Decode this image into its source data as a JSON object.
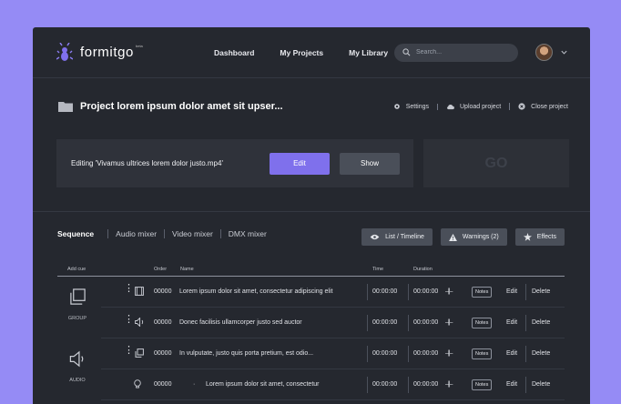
{
  "brand": {
    "name": "formitgo",
    "tm": "beta"
  },
  "nav": {
    "dashboard": "Dashboard",
    "projects": "My Projects",
    "library": "My Library"
  },
  "search": {
    "placeholder": "Search..."
  },
  "project": {
    "title": "Project lorem ipsum dolor amet sit upser...",
    "settings": "Settings",
    "upload": "Upload project",
    "close": "Close project"
  },
  "editor": {
    "label": "Editing 'Vivamus ultrices lorem dolor justo.mp4'",
    "edit": "Edit",
    "show": "Show",
    "go": "GO"
  },
  "tabs": [
    "Sequence",
    "Audio mixer",
    "Video mixer",
    "DMX mixer"
  ],
  "toolbar": {
    "list": "List / Timeline",
    "warnings": "Warnings (2)",
    "effects": "Effects"
  },
  "table": {
    "headers": {
      "add_cue": "Add cue",
      "order": "Order",
      "name": "Name",
      "time": "Time",
      "duration": "Duration"
    },
    "rows": [
      {
        "order": "00000",
        "name": "Lorem ipsum dolor sit amet, consectetur adipiscing elit",
        "time": "00:00:00",
        "duration": "00:00:00",
        "marker": "–||–",
        "notes": "Notes",
        "edit": "Edit",
        "delete": "Delete",
        "icon": "film-icon"
      },
      {
        "order": "00000",
        "name": "Donec facilisis ullamcorper justo sed auctor",
        "time": "00:00:00",
        "duration": "00:00:00",
        "marker": "–||–",
        "notes": "Notes",
        "edit": "Edit",
        "delete": "Delete",
        "icon": "speaker-icon"
      },
      {
        "order": "00000",
        "name": "In vulputate, justo quis porta pretium, est odio...",
        "time": "00:00:00",
        "duration": "00:00:00",
        "marker": "–||–",
        "notes": "Notes",
        "edit": "Edit",
        "delete": "Delete",
        "icon": "copy-icon"
      },
      {
        "order": "00000",
        "name": "Lorem ipsum dolor sit amet, consectetur",
        "time": "00:00:00",
        "duration": "00:00:00",
        "marker": "–||–",
        "notes": "Notes",
        "edit": "Edit",
        "delete": "Delete",
        "icon": "bulb-icon"
      }
    ]
  },
  "cues": {
    "group": "GROUP",
    "audio": "AUDIO"
  },
  "colors": {
    "accent": "#7f70ec",
    "background": "#958bf5",
    "panel": "#25282f"
  }
}
